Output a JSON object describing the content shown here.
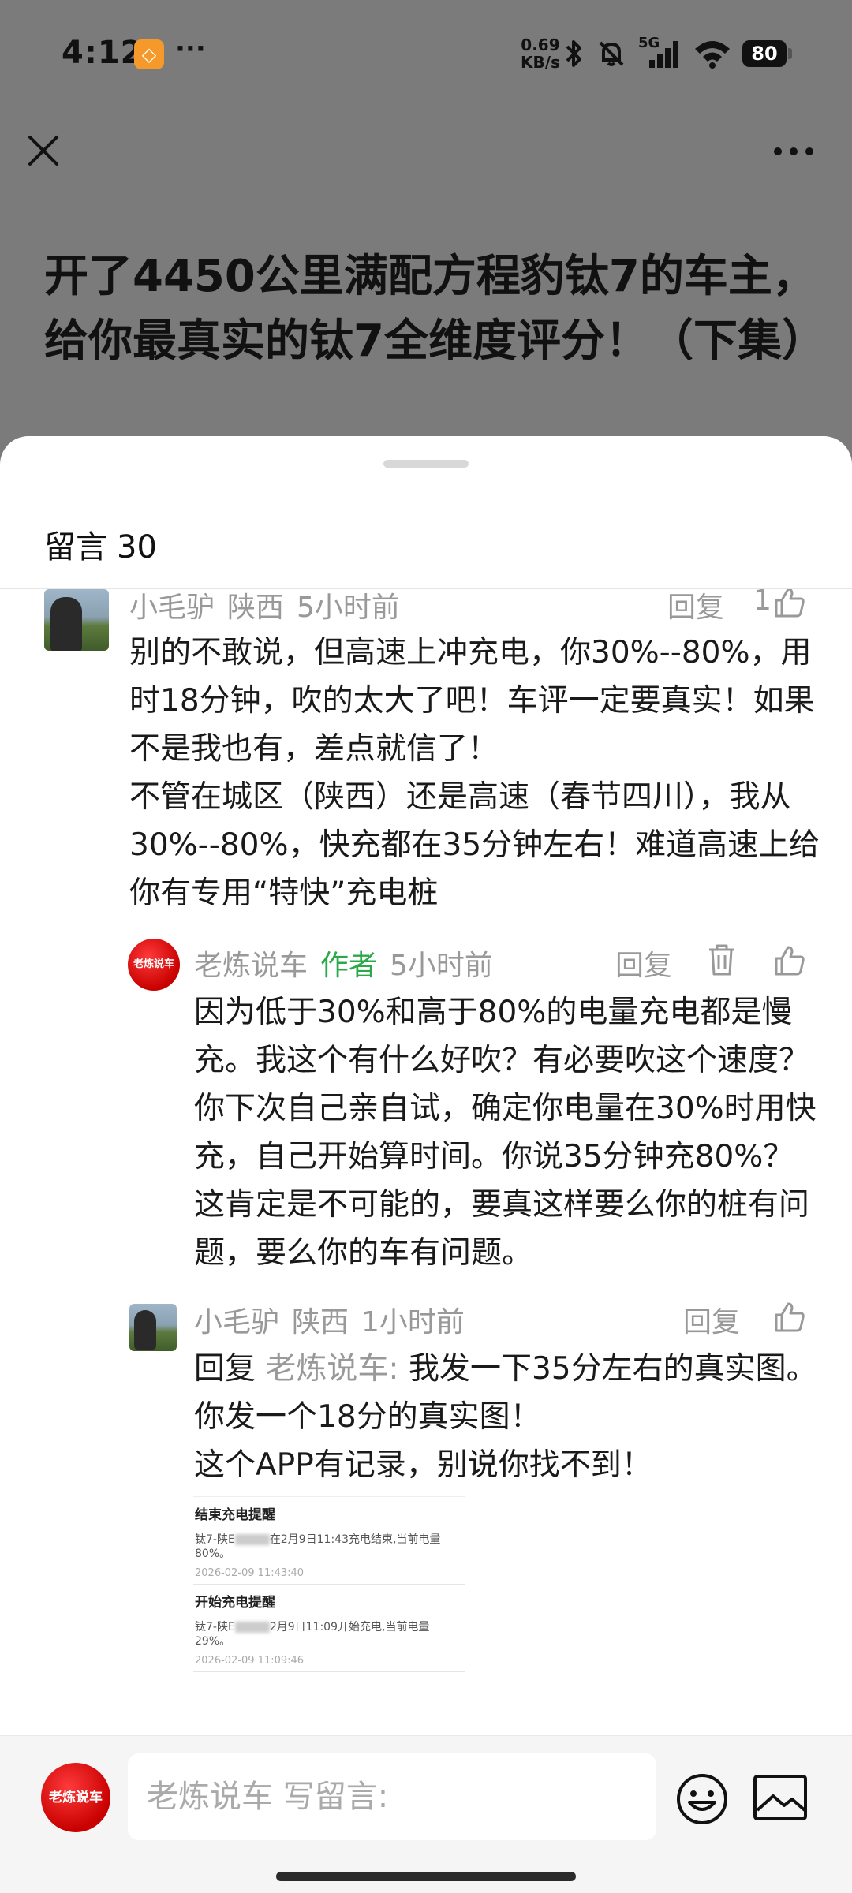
{
  "status_bar": {
    "time": "4:12",
    "app_badge": "◇",
    "dots": "···",
    "net_speed_value": "0.69",
    "net_speed_unit": "KB/s",
    "battery": "80",
    "signal_label": "5G"
  },
  "nav": {
    "close_icon": "close-icon",
    "more_icon": "more-icon"
  },
  "article": {
    "title": "开了4450公里满配方程豹钛7的车主，给你最真实的钛7全维度评分！（下集）"
  },
  "sheet": {
    "header_label": "留言",
    "header_count": "30"
  },
  "comments": [
    {
      "name": "小毛驴",
      "location": "陕西",
      "time": "5小时前",
      "reply_label": "回复",
      "likes": "1",
      "text": "别的不敢说，但高速上冲充电，你30%--80%，用时18分钟，吹的太大了吧！车评一定要真实！如果不是我也有，差点就信了！\n不管在城区（陕西）还是高速（春节四川），我从30%--80%，快充都在35分钟左右！难道高速上给你有专用“特快”充电桩"
    },
    {
      "name": "老炼说车",
      "author_tag": "作者",
      "time": "5小时前",
      "reply_label": "回复",
      "avatar_text": "老炼说车",
      "text": "因为低于30%和高于80%的电量充电都是慢充。我这个有什么好吹？有必要吹这个速度？你下次自己亲自试，确定你电量在30%时用快充，自己开始算时间。你说35分钟充80%？这肯定是不可能的，要真这样要么你的桩有问题，要么你的车有问题。"
    },
    {
      "name": "小毛驴",
      "location": "陕西",
      "time": "1小时前",
      "reply_label": "回复",
      "reply_prefix": "回复",
      "reply_to": "老炼说车:",
      "text": " 我发一下35分左右的真实图。你发一个18分的真实图！\n这个APP有记录，别说你找不到！",
      "attachment": {
        "items": [
          {
            "title": "结束充电提醒",
            "text_prefix": "钛7-陕E",
            "text_suffix": "在2月9日11:43充电结束,当前电量80%。",
            "time": "2026-02-09 11:43:40"
          },
          {
            "title": "开始充电提醒",
            "text_prefix": "钛7-陕E",
            "text_suffix": "2月9日11:09开始充电,当前电量29%。",
            "time": "2026-02-09 11:09:46"
          }
        ]
      }
    }
  ],
  "bottom_bar": {
    "avatar_text": "老炼说车",
    "input_placeholder": "老炼说车 写留言:"
  }
}
